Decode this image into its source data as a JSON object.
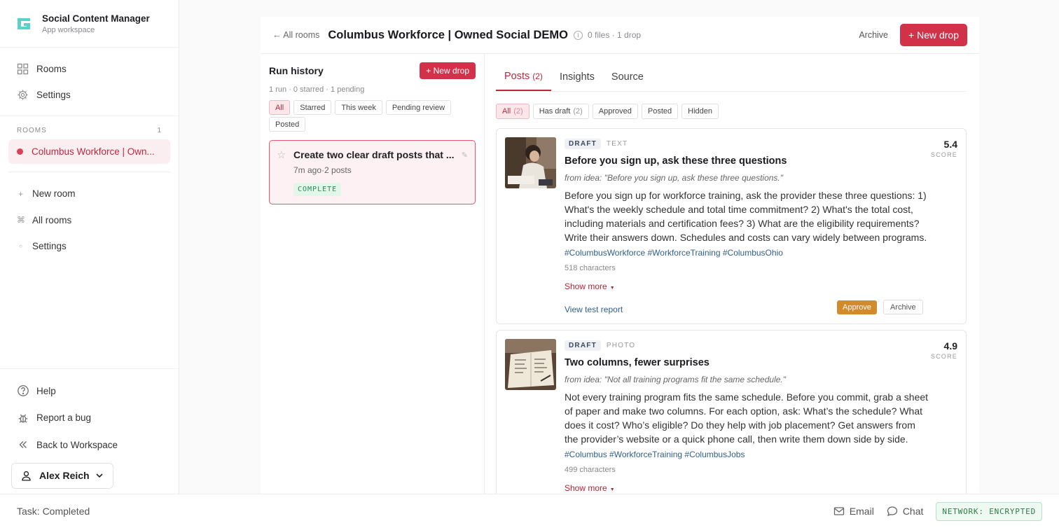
{
  "sidebar": {
    "app_title": "Social Content Manager",
    "app_subtitle": "App workspace",
    "nav": [
      {
        "label": "Rooms",
        "icon": "grid-icon"
      },
      {
        "label": "Settings",
        "icon": "gear-icon"
      }
    ],
    "rooms_header": "ROOMS",
    "rooms_count": "1",
    "active_room": "Columbus Workforce | Own...",
    "secondary": [
      {
        "label": "New room",
        "glyph": "+"
      },
      {
        "label": "All rooms",
        "glyph": "⌘"
      },
      {
        "label": "Settings",
        "glyph": "○"
      }
    ],
    "bottom": [
      {
        "label": "Help",
        "icon": "help-icon"
      },
      {
        "label": "Report a bug",
        "icon": "bug-icon"
      },
      {
        "label": "Back to Workspace",
        "icon": "double-chevron-left-icon"
      }
    ],
    "user_name": "Alex Reich"
  },
  "header": {
    "back_label": "← All rooms",
    "title": "Columbus Workforce | Owned Social DEMO",
    "meta": "0 files · 1 drop",
    "archive_label": "Archive",
    "new_drop_label": "+ New drop"
  },
  "run_history": {
    "title": "Run history",
    "new_drop_label": "+ New drop",
    "meta": "1 run · 0 starred · 1 pending",
    "filters": [
      "All",
      "Starred",
      "This week",
      "Pending review",
      "Posted"
    ],
    "run": {
      "title": "Create two clear draft posts that ...",
      "subtitle": "7m ago·2 posts",
      "status": "COMPLETE"
    }
  },
  "tabs": [
    {
      "label": "Posts",
      "count": "(2)"
    },
    {
      "label": "Insights",
      "count": ""
    },
    {
      "label": "Source",
      "count": ""
    }
  ],
  "post_filters": [
    {
      "label": "All",
      "count": "(2)"
    },
    {
      "label": "Has draft",
      "count": "(2)"
    },
    {
      "label": "Approved",
      "count": ""
    },
    {
      "label": "Posted",
      "count": ""
    },
    {
      "label": "Hidden",
      "count": ""
    }
  ],
  "posts": [
    {
      "badge": "DRAFT",
      "kind": "TEXT",
      "title": "Before you sign up, ask these three questions",
      "idea": "from idea: \"Before you sign up, ask these three questions.\"",
      "text": "Before you sign up for workforce training, ask the provider these three questions: 1) What's the weekly schedule and total time commitment? 2) What's the total cost, including materials and certification fees? 3) What are the eligibility requirements? Write their answers down. Schedules and costs can vary widely between programs.",
      "hashtags": "#ColumbusWorkforce #WorkforceTraining #ColumbusOhio",
      "chars": "518 characters",
      "show_more": "Show more",
      "report": "View test report",
      "approve": "Approve",
      "archive": "Archive",
      "score": "5.4",
      "score_label": "SCORE"
    },
    {
      "badge": "DRAFT",
      "kind": "PHOTO",
      "title": "Two columns, fewer surprises",
      "idea": "from idea: \"Not all training programs fit the same schedule.\"",
      "text": "Not every training program fits the same schedule. Before you commit, grab a sheet of paper and make two columns. For each option, ask: What’s the schedule? What does it cost? Who’s eligible? Do they help with job placement? Get answers from the provider’s website or a quick phone call, then write them down side by side.",
      "hashtags": "#Columbus #WorkforceTraining #ColumbusJobs",
      "chars": "499 characters",
      "show_more": "Show more",
      "score": "4.9",
      "score_label": "SCORE"
    }
  ],
  "footer": {
    "task": "Task: Completed",
    "email": "Email",
    "chat": "Chat",
    "network": "NETWORK: ENCRYPTED"
  },
  "colors": {
    "accent": "#d2314a",
    "approve": "#d28a2b",
    "link": "#2f5f8a",
    "success": "#2f8a55"
  }
}
